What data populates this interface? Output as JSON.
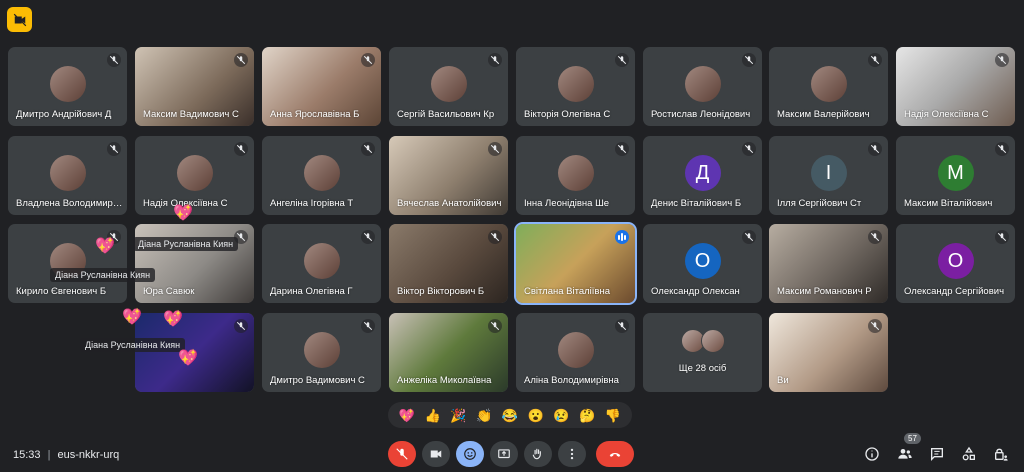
{
  "meeting": {
    "time": "15:33",
    "code": "eus-nkkr-urq",
    "people_count": "57",
    "more_label": "Ще 28 осіб"
  },
  "colors": {
    "bg": "#202124",
    "tile": "#3c4043",
    "end_call": "#ea4335",
    "mic_off": "#ea4335",
    "accent": "#8ab4f8",
    "top_button": "#fbbc04"
  },
  "participants": [
    {
      "name": "Дмитро Андрійович Д"
    },
    {
      "name": "Максим Вадимович С"
    },
    {
      "name": "Анна Ярославівна Б"
    },
    {
      "name": "Сергій Васильович Кр"
    },
    {
      "name": "Вікторія Олегівна С"
    },
    {
      "name": "Ростислав Леонідович"
    },
    {
      "name": "Максим Валерійович"
    },
    {
      "name": "Надія Олексіївна С"
    },
    {
      "name": "Владлена Володимирівна"
    },
    {
      "name": "Надія Олексіївна С"
    },
    {
      "name": "Ангеліна Ігорівна Т"
    },
    {
      "name": "Вячеслав Анатолійович"
    },
    {
      "name": "Інна Леонідівна Ше"
    },
    {
      "name": "Денис Віталійович Б",
      "initial": "Д"
    },
    {
      "name": "Ілля Сергійович Ст",
      "initial": "І"
    },
    {
      "name": "Максим Віталійович",
      "initial": "М"
    },
    {
      "name": "Кирило Євгенович Б"
    },
    {
      "name": "Юра Савюк"
    },
    {
      "name": "Дарина Олегівна Г"
    },
    {
      "name": "Віктор Вікторович Б"
    },
    {
      "name": "Світлана Віталіївна"
    },
    {
      "name": "Олександр Олексан",
      "initial": "О"
    },
    {
      "name": "Максим Романович Р"
    },
    {
      "name": "Олександр Сергійович",
      "initial": "О"
    },
    {
      "name": ""
    },
    {
      "name": "Дмитро Вадимович С"
    },
    {
      "name": "Анжеліка Миколаївна"
    },
    {
      "name": "Аліна Володимирівна"
    },
    {
      "name": "Ви"
    }
  ],
  "reaction_tag": "Діана Русланівна Киян",
  "reaction_tag_overlap": "Діана Русланівна Киян",
  "reactions": [
    "💖",
    "👍",
    "🎉",
    "👏",
    "😂",
    "😮",
    "😢",
    "🤔",
    "👎"
  ],
  "heart_emoji": "💖"
}
